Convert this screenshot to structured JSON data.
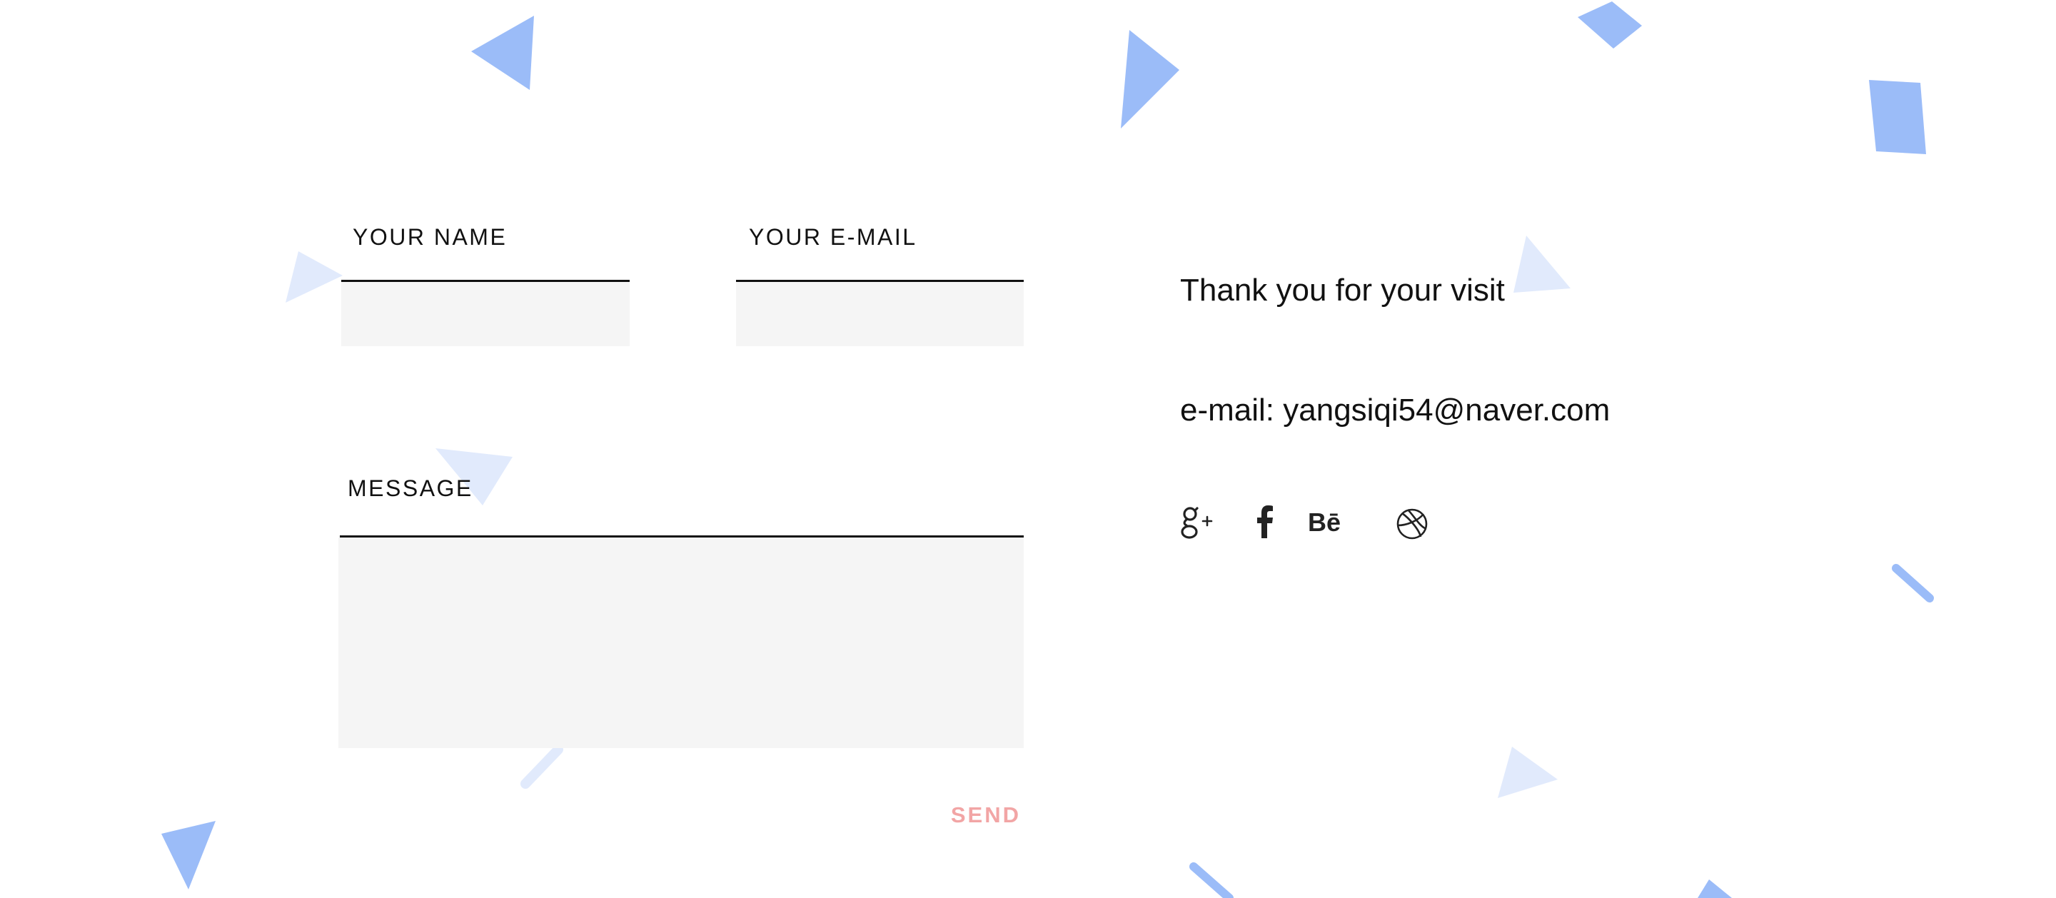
{
  "form": {
    "name_label": "YOUR NAME",
    "name_value": "",
    "email_label": "YOUR E-MAIL",
    "email_value": "",
    "message_label": "MESSAGE",
    "message_value": "",
    "send_label": "SEND"
  },
  "contact": {
    "thanks_text": "Thank you for your visit",
    "email_text": "e-mail: yangsiqi54@naver.com"
  },
  "social": [
    {
      "name": "google-plus",
      "icon": "google-plus-icon"
    },
    {
      "name": "facebook",
      "icon": "facebook-icon"
    },
    {
      "name": "behance",
      "icon": "behance-icon"
    },
    {
      "name": "dribbble",
      "icon": "dribbble-icon"
    }
  ],
  "colors": {
    "background": "#ffffff",
    "input_fill": "#f5f5f5",
    "text": "#111111",
    "send": "#f2a5a5",
    "confetti_strong": "#9bbcf8",
    "confetti_light": "#e1eafc"
  }
}
